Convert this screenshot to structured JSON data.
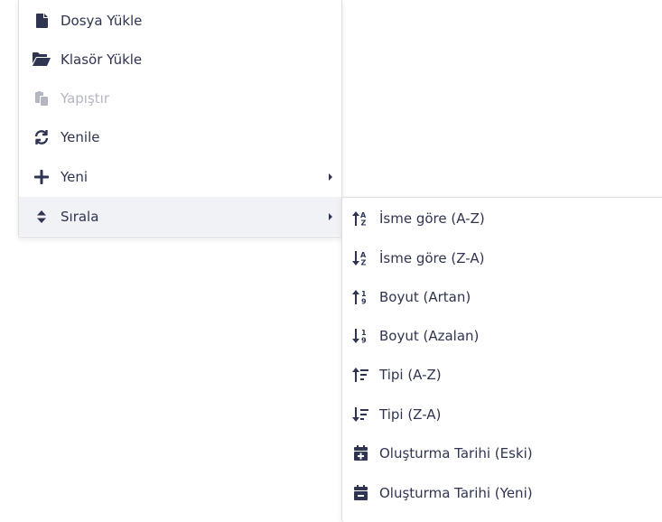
{
  "main_menu": {
    "items": [
      {
        "label": "Dosya Yükle",
        "icon": "file-icon"
      },
      {
        "label": "Klasör Yükle",
        "icon": "folder-open-icon"
      },
      {
        "label": "Yapıştır",
        "icon": "paste-icon",
        "disabled": true
      },
      {
        "label": "Yenile",
        "icon": "refresh-icon"
      },
      {
        "label": "Yeni",
        "icon": "plus-icon",
        "has_submenu": true
      },
      {
        "label": "Sırala",
        "icon": "sort-icon",
        "has_submenu": true,
        "active": true
      }
    ]
  },
  "sort_submenu": {
    "items": [
      {
        "label": "İsme göre (A-Z)",
        "icon": "sort-alpha-asc-icon"
      },
      {
        "label": "İsme göre (Z-A)",
        "icon": "sort-alpha-desc-icon"
      },
      {
        "label": "Boyut (Artan)",
        "icon": "sort-numeric-asc-icon"
      },
      {
        "label": "Boyut (Azalan)",
        "icon": "sort-numeric-desc-icon"
      },
      {
        "label": "Tipi (A-Z)",
        "icon": "sort-amount-asc-icon"
      },
      {
        "label": "Tipi (Z-A)",
        "icon": "sort-amount-desc-icon"
      },
      {
        "label": "Oluşturma Tarihi (Eski)",
        "icon": "calendar-plus-icon"
      },
      {
        "label": "Oluşturma Tarihi (Yeni)",
        "icon": "calendar-minus-icon"
      }
    ]
  },
  "colors": {
    "text": "#2f3450",
    "disabled_text": "#b4b6c1",
    "active_background": "#f1f2f6",
    "border": "#dedfe4"
  }
}
